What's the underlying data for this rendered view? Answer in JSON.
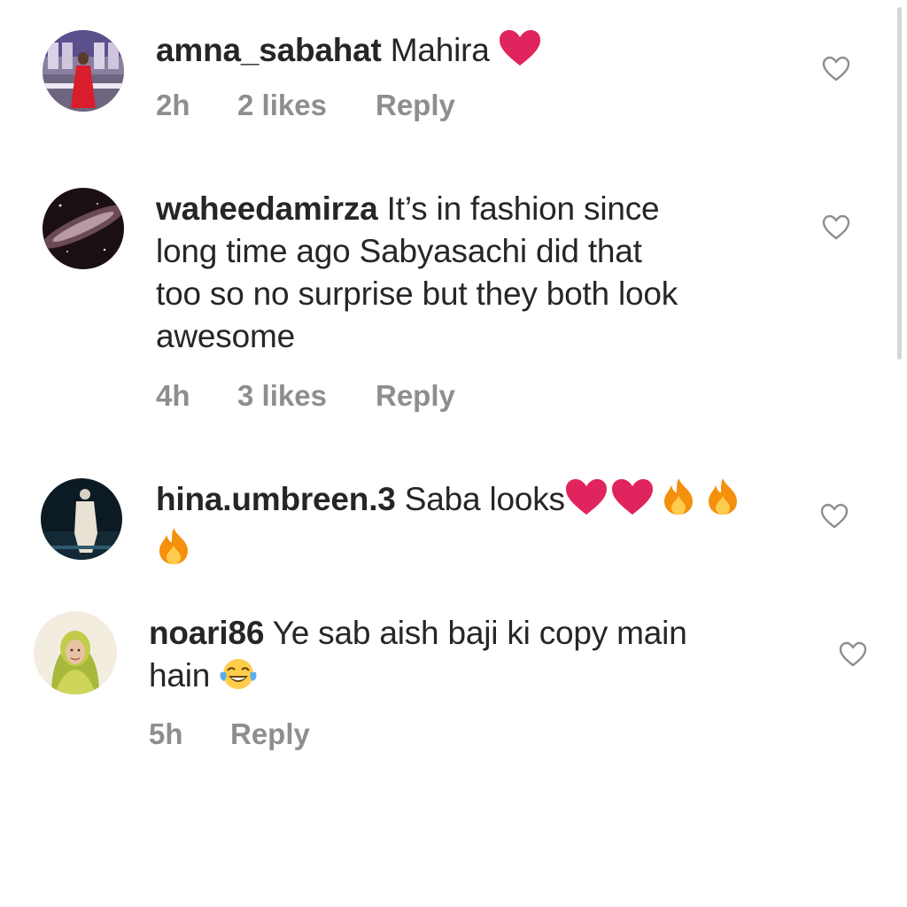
{
  "comments": [
    {
      "username": "amna_sabahat",
      "text": "Mahira",
      "emoji": [
        "red-heart"
      ],
      "time": "2h",
      "likes": "2 likes",
      "reply": "Reply"
    },
    {
      "username": "waheedamirza",
      "text": "It’s in fashion since long time ago Sabyasachi did that too so no surprise but they both look awesome",
      "lines": [
        "It’s in fashion since",
        "long time ago Sabyasachi did that",
        "too so no surprise but they both look",
        "awesome"
      ],
      "time": "4h",
      "likes": "3 likes",
      "reply": "Reply"
    },
    {
      "username": "hina.umbreen.3",
      "text": "Saba looks",
      "emoji": [
        "red-heart",
        "red-heart",
        "fire",
        "fire",
        "fire"
      ],
      "time": "",
      "likes": "",
      "reply": ""
    },
    {
      "username": "noari86",
      "text": "Ye sab aish baji ki copy main hain",
      "lines": [
        "Ye sab aish baji ki copy main",
        "hain"
      ],
      "emoji": [
        "face-with-tears-of-joy"
      ],
      "time": "5h",
      "likes": "",
      "reply": "Reply"
    }
  ],
  "colors": {
    "text": "#262626",
    "meta": "#8e8e8e",
    "heart_red": "#e0245e",
    "fire": "#f4900c",
    "scrollbar": "#d6d6d6"
  },
  "icons": {
    "like": "heart-outline-icon",
    "heart": "red-heart-emoji",
    "fire": "fire-emoji",
    "laugh": "tears-of-joy-emoji"
  }
}
